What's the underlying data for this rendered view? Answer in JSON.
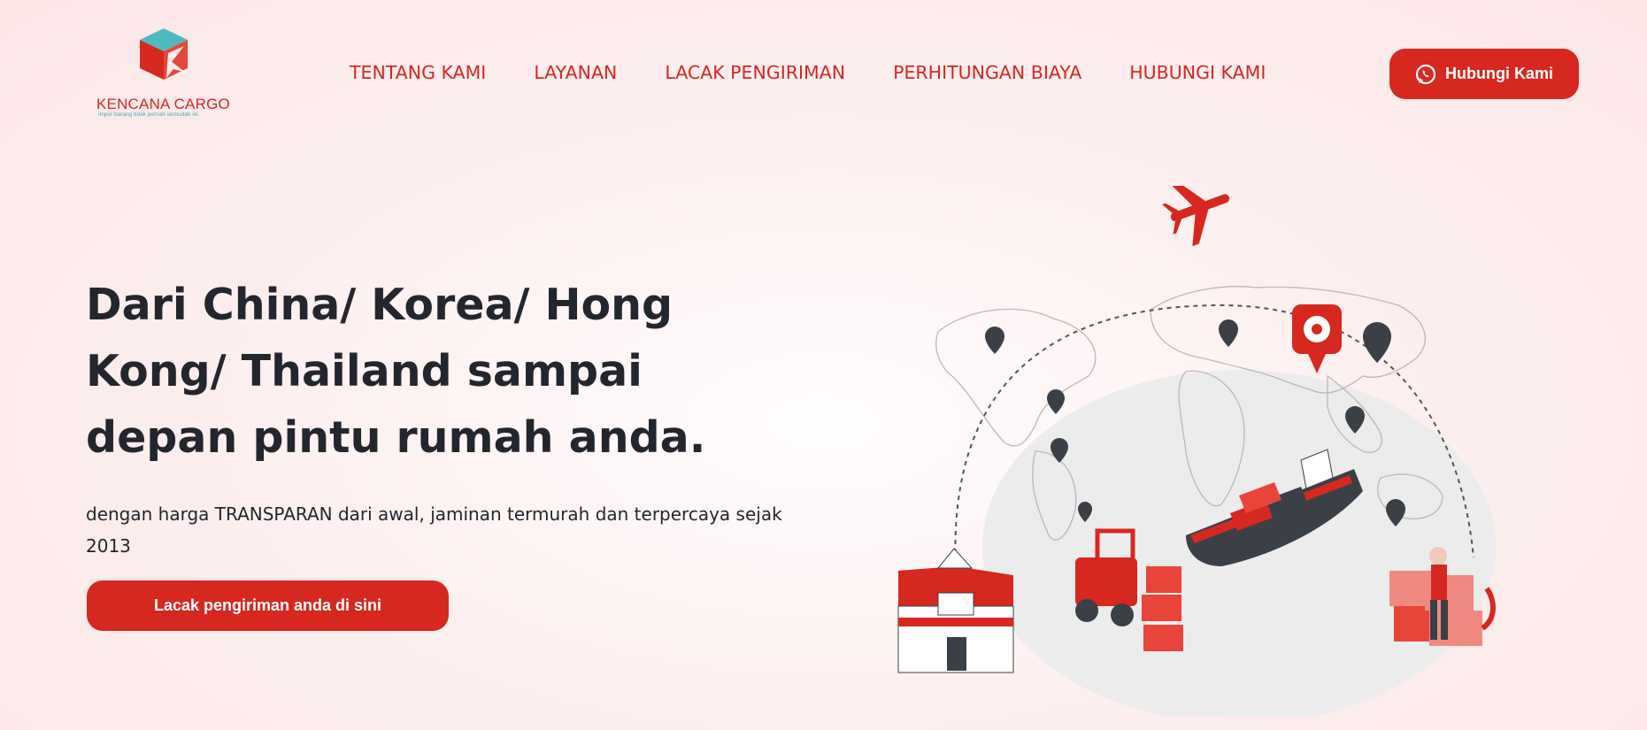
{
  "header": {
    "logo": {
      "name": "KENCANA CARGO",
      "tagline": "impor barang tidak pernah semudah ini."
    },
    "nav": [
      {
        "label": "TENTANG KAMI"
      },
      {
        "label": "LAYANAN"
      },
      {
        "label": "LACAK PENGIRIMAN"
      },
      {
        "label": "PERHITUNGAN BIAYA"
      },
      {
        "label": "HUBUNGI KAMI"
      }
    ],
    "cta": {
      "label": "Hubungi Kami",
      "icon": "whatsapp-icon"
    }
  },
  "hero": {
    "title": "Dari China/ Korea/ Hong Kong/ Thailand sampai depan pintu rumah anda.",
    "subtitle": "dengan harga TRANSPARAN dari awal, jaminan termurah dan terpercaya sejak 2013",
    "button_label": "Lacak pengiriman anda di sini"
  },
  "illustration": {
    "icons": [
      "airplane-icon",
      "map-pin-icon",
      "gear-pin-icon",
      "cargo-ship",
      "forklift",
      "warehouse",
      "courier-with-boxes"
    ]
  },
  "colors": {
    "brand_red": "#d6281f",
    "brand_teal": "#4fb9c1",
    "text_dark": "#23262d",
    "bg_pink": "#fbe6e6"
  }
}
